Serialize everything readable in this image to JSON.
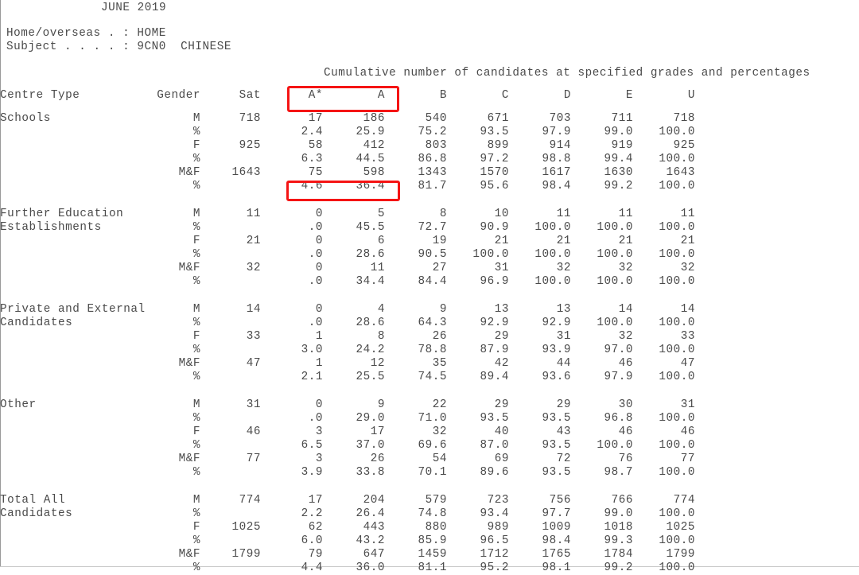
{
  "report": {
    "title": "JUNE 2019",
    "meta": [
      {
        "label": "Home/overseas . :",
        "value": "HOME",
        "line": "Home/overseas . : HOME"
      },
      {
        "label": "Subject . . . . :",
        "value": "9CN0  CHINESE",
        "line": "Subject . . . . : 9CN0  CHINESE"
      }
    ],
    "cumulative_label": "Cumulative number of candidates at specified grades and percentages"
  },
  "table": {
    "headers": {
      "centre_type": "Centre Type",
      "gender": "Gender",
      "sat": "Sat",
      "grades": [
        "A*",
        "A",
        "B",
        "C",
        "D",
        "E",
        "U"
      ]
    },
    "groups": [
      {
        "name": "Schools",
        "name_lines": [
          "Schools",
          ""
        ],
        "rows": [
          {
            "gender": "M",
            "sat": "718",
            "values": [
              "17",
              "186",
              "540",
              "671",
              "703",
              "711",
              "718"
            ]
          },
          {
            "gender": "%",
            "sat": "",
            "values": [
              "2.4",
              "25.9",
              "75.2",
              "93.5",
              "97.9",
              "99.0",
              "100.0"
            ]
          },
          {
            "gender": "F",
            "sat": "925",
            "values": [
              "58",
              "412",
              "803",
              "899",
              "914",
              "919",
              "925"
            ]
          },
          {
            "gender": "%",
            "sat": "",
            "values": [
              "6.3",
              "44.5",
              "86.8",
              "97.2",
              "98.8",
              "99.4",
              "100.0"
            ]
          },
          {
            "gender": "M&F",
            "sat": "1643",
            "values": [
              "75",
              "598",
              "1343",
              "1570",
              "1617",
              "1630",
              "1643"
            ]
          },
          {
            "gender": "%",
            "sat": "",
            "values": [
              "4.6",
              "36.4",
              "81.7",
              "95.6",
              "98.4",
              "99.2",
              "100.0"
            ]
          }
        ]
      },
      {
        "name": "Further Education Establishments",
        "name_lines": [
          "Further Education",
          "Establishments"
        ],
        "rows": [
          {
            "gender": "M",
            "sat": "11",
            "values": [
              "0",
              "5",
              "8",
              "10",
              "11",
              "11",
              "11"
            ]
          },
          {
            "gender": "%",
            "sat": "",
            "values": [
              ".0",
              "45.5",
              "72.7",
              "90.9",
              "100.0",
              "100.0",
              "100.0"
            ]
          },
          {
            "gender": "F",
            "sat": "21",
            "values": [
              "0",
              "6",
              "19",
              "21",
              "21",
              "21",
              "21"
            ]
          },
          {
            "gender": "%",
            "sat": "",
            "values": [
              ".0",
              "28.6",
              "90.5",
              "100.0",
              "100.0",
              "100.0",
              "100.0"
            ]
          },
          {
            "gender": "M&F",
            "sat": "32",
            "values": [
              "0",
              "11",
              "27",
              "31",
              "32",
              "32",
              "32"
            ]
          },
          {
            "gender": "%",
            "sat": "",
            "values": [
              ".0",
              "34.4",
              "84.4",
              "96.9",
              "100.0",
              "100.0",
              "100.0"
            ]
          }
        ]
      },
      {
        "name": "Private and External Candidates",
        "name_lines": [
          "Private and External",
          "Candidates"
        ],
        "rows": [
          {
            "gender": "M",
            "sat": "14",
            "values": [
              "0",
              "4",
              "9",
              "13",
              "13",
              "14",
              "14"
            ]
          },
          {
            "gender": "%",
            "sat": "",
            "values": [
              ".0",
              "28.6",
              "64.3",
              "92.9",
              "92.9",
              "100.0",
              "100.0"
            ]
          },
          {
            "gender": "F",
            "sat": "33",
            "values": [
              "1",
              "8",
              "26",
              "29",
              "31",
              "32",
              "33"
            ]
          },
          {
            "gender": "%",
            "sat": "",
            "values": [
              "3.0",
              "24.2",
              "78.8",
              "87.9",
              "93.9",
              "97.0",
              "100.0"
            ]
          },
          {
            "gender": "M&F",
            "sat": "47",
            "values": [
              "1",
              "12",
              "35",
              "42",
              "44",
              "46",
              "47"
            ]
          },
          {
            "gender": "%",
            "sat": "",
            "values": [
              "2.1",
              "25.5",
              "74.5",
              "89.4",
              "93.6",
              "97.9",
              "100.0"
            ]
          }
        ]
      },
      {
        "name": "Other",
        "name_lines": [
          "Other",
          ""
        ],
        "rows": [
          {
            "gender": "M",
            "sat": "31",
            "values": [
              "0",
              "9",
              "22",
              "29",
              "29",
              "30",
              "31"
            ]
          },
          {
            "gender": "%",
            "sat": "",
            "values": [
              ".0",
              "29.0",
              "71.0",
              "93.5",
              "93.5",
              "96.8",
              "100.0"
            ]
          },
          {
            "gender": "F",
            "sat": "46",
            "values": [
              "3",
              "17",
              "32",
              "40",
              "43",
              "46",
              "46"
            ]
          },
          {
            "gender": "%",
            "sat": "",
            "values": [
              "6.5",
              "37.0",
              "69.6",
              "87.0",
              "93.5",
              "100.0",
              "100.0"
            ]
          },
          {
            "gender": "M&F",
            "sat": "77",
            "values": [
              "3",
              "26",
              "54",
              "69",
              "72",
              "76",
              "77"
            ]
          },
          {
            "gender": "%",
            "sat": "",
            "values": [
              "3.9",
              "33.8",
              "70.1",
              "89.6",
              "93.5",
              "98.7",
              "100.0"
            ]
          }
        ]
      },
      {
        "name": "Total All Candidates",
        "name_lines": [
          "Total All",
          "Candidates"
        ],
        "rows": [
          {
            "gender": "M",
            "sat": "774",
            "values": [
              "17",
              "204",
              "579",
              "723",
              "756",
              "766",
              "774"
            ]
          },
          {
            "gender": "%",
            "sat": "",
            "values": [
              "2.2",
              "26.4",
              "74.8",
              "93.4",
              "97.7",
              "99.0",
              "100.0"
            ]
          },
          {
            "gender": "F",
            "sat": "1025",
            "values": [
              "62",
              "443",
              "880",
              "989",
              "1009",
              "1018",
              "1025"
            ]
          },
          {
            "gender": "%",
            "sat": "",
            "values": [
              "6.0",
              "43.2",
              "85.9",
              "96.5",
              "98.4",
              "99.3",
              "100.0"
            ]
          },
          {
            "gender": "M&F",
            "sat": "1799",
            "values": [
              "79",
              "647",
              "1459",
              "1712",
              "1765",
              "1784",
              "1799"
            ]
          },
          {
            "gender": "%",
            "sat": "",
            "values": [
              "4.4",
              "36.0",
              "81.1",
              "95.2",
              "98.1",
              "99.2",
              "100.0"
            ]
          }
        ]
      }
    ]
  },
  "annotations": {
    "color": "#f51414",
    "boxes": [
      {
        "id": "grade-header",
        "targets": "A* and A column headers"
      },
      {
        "id": "schools-mf-pct",
        "targets": "Schools M&F percentage 4.6 36.4"
      }
    ]
  },
  "colors": {
    "text": "#4a4a4a",
    "background": "#ffffff",
    "annotation": "#f51414",
    "page_border": "#9a9a9a"
  }
}
